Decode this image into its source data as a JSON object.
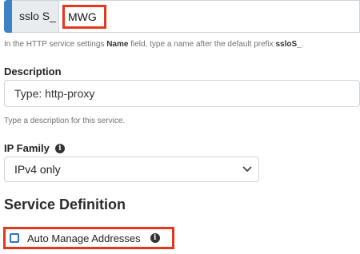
{
  "name_field": {
    "prefix": "sslo S_",
    "value": "MWG",
    "help_before": "In the HTTP service settings ",
    "help_bold_1": "Name",
    "help_middle": " field, type a name after the default prefix ",
    "help_bold_2": "ssloS_",
    "help_after": "."
  },
  "description": {
    "label": "Description",
    "value": "Type: http-proxy",
    "help": "Type a description for this service."
  },
  "ip_family": {
    "label": "IP Family",
    "selected": "IPv4 only"
  },
  "service_definition": {
    "title": "Service Definition",
    "auto_manage_label": "Auto Manage Addresses",
    "auto_manage_checked": false
  },
  "colors": {
    "highlight": "#e8361d",
    "accent": "#3b82c6",
    "checkbox": "#2f6fd6"
  },
  "icons": [
    "info-icon",
    "chevron-down-icon",
    "checkbox-icon"
  ]
}
